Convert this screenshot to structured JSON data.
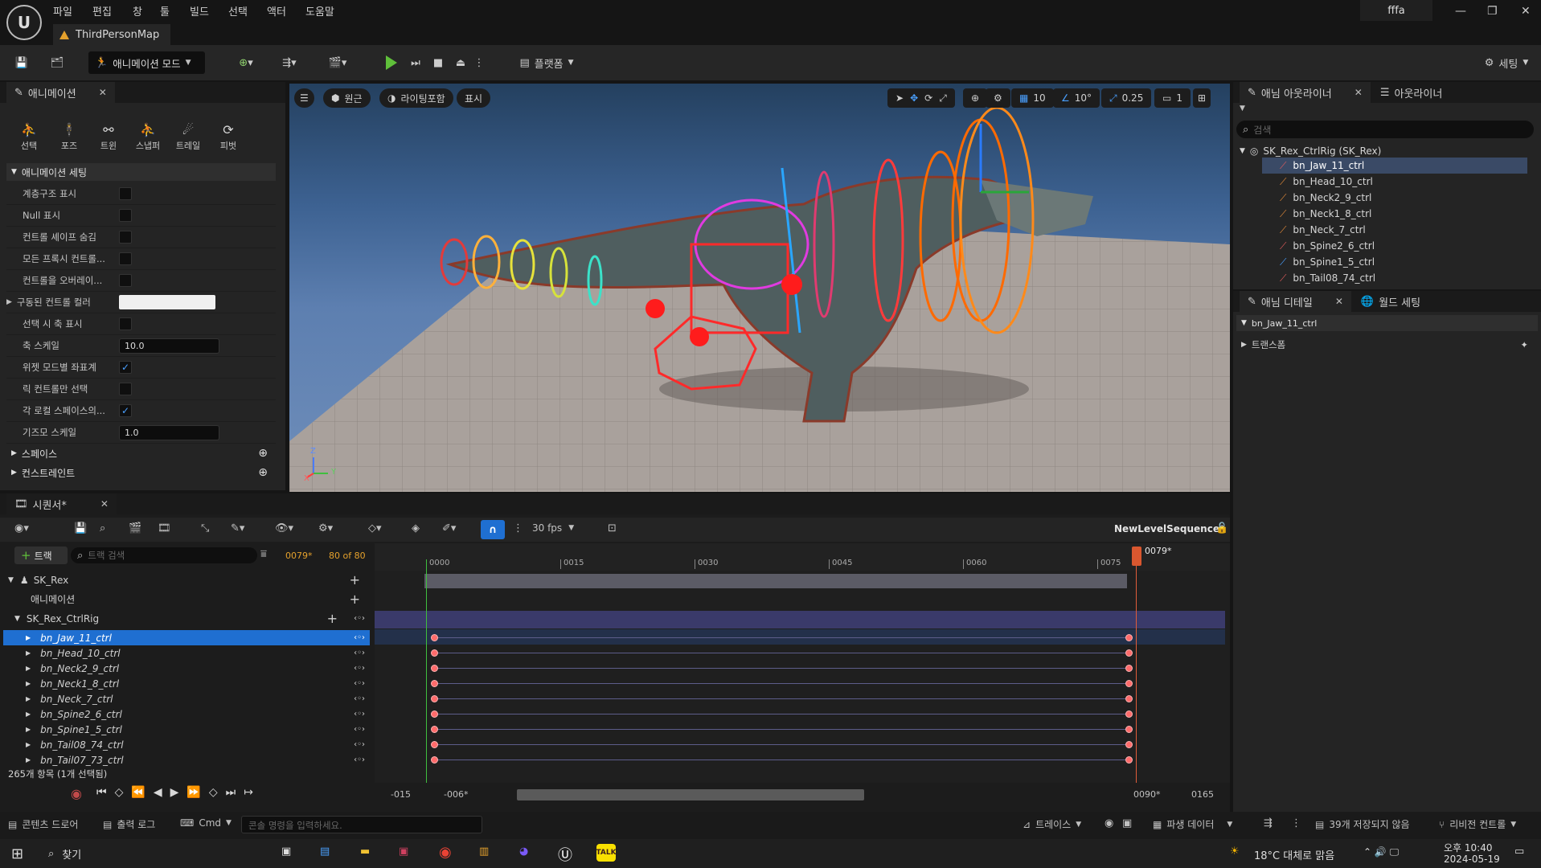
{
  "menu": {
    "items": [
      "파일",
      "편집",
      "창",
      "툴",
      "빌드",
      "선택",
      "액터",
      "도움말"
    ],
    "user": "fffa",
    "map_tab": "ThirdPersonMap"
  },
  "toolbar": {
    "mode_label": "애니메이션 모드",
    "platforms_label": "플랫폼",
    "settings_label": "세팅"
  },
  "animation_panel": {
    "tab_label": "애니메이션",
    "tools": [
      "선택",
      "포즈",
      "트윈",
      "스냅퍼",
      "트레일",
      "피벗"
    ],
    "section_title": "애니메이션 세팅",
    "rows": [
      {
        "label": "계층구조 표시",
        "type": "check",
        "value": false
      },
      {
        "label": "Null 표시",
        "type": "check",
        "value": false
      },
      {
        "label": "컨트롤 셰이프 숨김",
        "type": "check",
        "value": false
      },
      {
        "label": "모든 프록시 컨트롤...",
        "type": "check",
        "value": false
      },
      {
        "label": "컨트롤을 오버레이...",
        "type": "check",
        "value": false
      },
      {
        "label": "구동된 컨트롤 컬러",
        "type": "color",
        "value": "#f0f0f0"
      },
      {
        "label": "선택 시 축 표시",
        "type": "check",
        "value": false
      },
      {
        "label": "축 스케일",
        "type": "number",
        "value": "10.0"
      },
      {
        "label": "위젯 모드별 좌표계",
        "type": "check",
        "value": true
      },
      {
        "label": "릭 컨트롤만 선택",
        "type": "check",
        "value": false
      },
      {
        "label": "각 로컬 스페이스의...",
        "type": "check",
        "value": true
      },
      {
        "label": "기즈모 스케일",
        "type": "number",
        "value": "1.0"
      }
    ],
    "sections": [
      "스페이스",
      "컨스트레인트"
    ]
  },
  "viewport": {
    "perspective": "원근",
    "lighting": "라이팅포함",
    "show": "표시",
    "grid_value": "10",
    "angle_value": "10°",
    "scale_value": "0.25",
    "camera_value": "1",
    "axis_labels": [
      "Z",
      "X",
      "Y"
    ]
  },
  "anim_outliner": {
    "tab_label": "애님 아웃라이너",
    "tab2_label": "아웃라이너",
    "search_placeholder": "검색",
    "root": "SK_Rex_CtrlRig (SK_Rex)",
    "items": [
      "bn_Jaw_11_ctrl",
      "bn_Head_10_ctrl",
      "bn_Neck2_9_ctrl",
      "bn_Neck1_8_ctrl",
      "bn_Neck_7_ctrl",
      "bn_Spine2_6_ctrl",
      "bn_Spine1_5_ctrl",
      "bn_Tail08_74_ctrl"
    ]
  },
  "anim_details": {
    "tab_label": "애님 디테일",
    "tab2_label": "월드 세팅",
    "selected": "bn_Jaw_11_ctrl",
    "section": "트랜스폼"
  },
  "sequencer": {
    "tab_label": "시퀀서*",
    "fps": "30 fps",
    "sequence_name": "NewLevelSequence*",
    "add_track": "트랙",
    "search_placeholder": "트랙 검색",
    "current_frame": "0079*",
    "frame_count": "80 of 80",
    "playhead_label": "0079*",
    "ruler": [
      "0000",
      "0015",
      "0030",
      "0045",
      "0060",
      "0075"
    ],
    "tracks": [
      {
        "label": "SK_Rex",
        "indent": 0
      },
      {
        "label": "애니메이션",
        "indent": 1
      },
      {
        "label": "SK_Rex_CtrlRig",
        "indent": 1
      }
    ],
    "controls": [
      "bn_Jaw_11_ctrl",
      "bn_Head_10_ctrl",
      "bn_Neck2_9_ctrl",
      "bn_Neck1_8_ctrl",
      "bn_Neck_7_ctrl",
      "bn_Spine2_6_ctrl",
      "bn_Spine1_5_ctrl",
      "bn_Tail08_74_ctrl",
      "bn_Tail07_73_ctrl"
    ],
    "status": "265개 항목 (1개 선택됨)",
    "range_start_outer": "-015",
    "range_start_inner": "-006*",
    "range_end_inner": "0090*",
    "range_end_outer": "0165"
  },
  "statusbar": {
    "content_drawer": "콘텐츠 드로어",
    "output_log": "출력 로그",
    "cmd": "Cmd",
    "console_placeholder": "콘솔 명령을 입력하세요.",
    "trace": "트레이스",
    "derived_data": "파생 데이터",
    "unsaved": "39개 저장되지 않음",
    "revision": "리비전 컨트롤"
  },
  "taskbar": {
    "search_label": "찾기",
    "weather": "18°C 대체로 맑음",
    "time": "오후 10:40",
    "date": "2024-05-19"
  }
}
